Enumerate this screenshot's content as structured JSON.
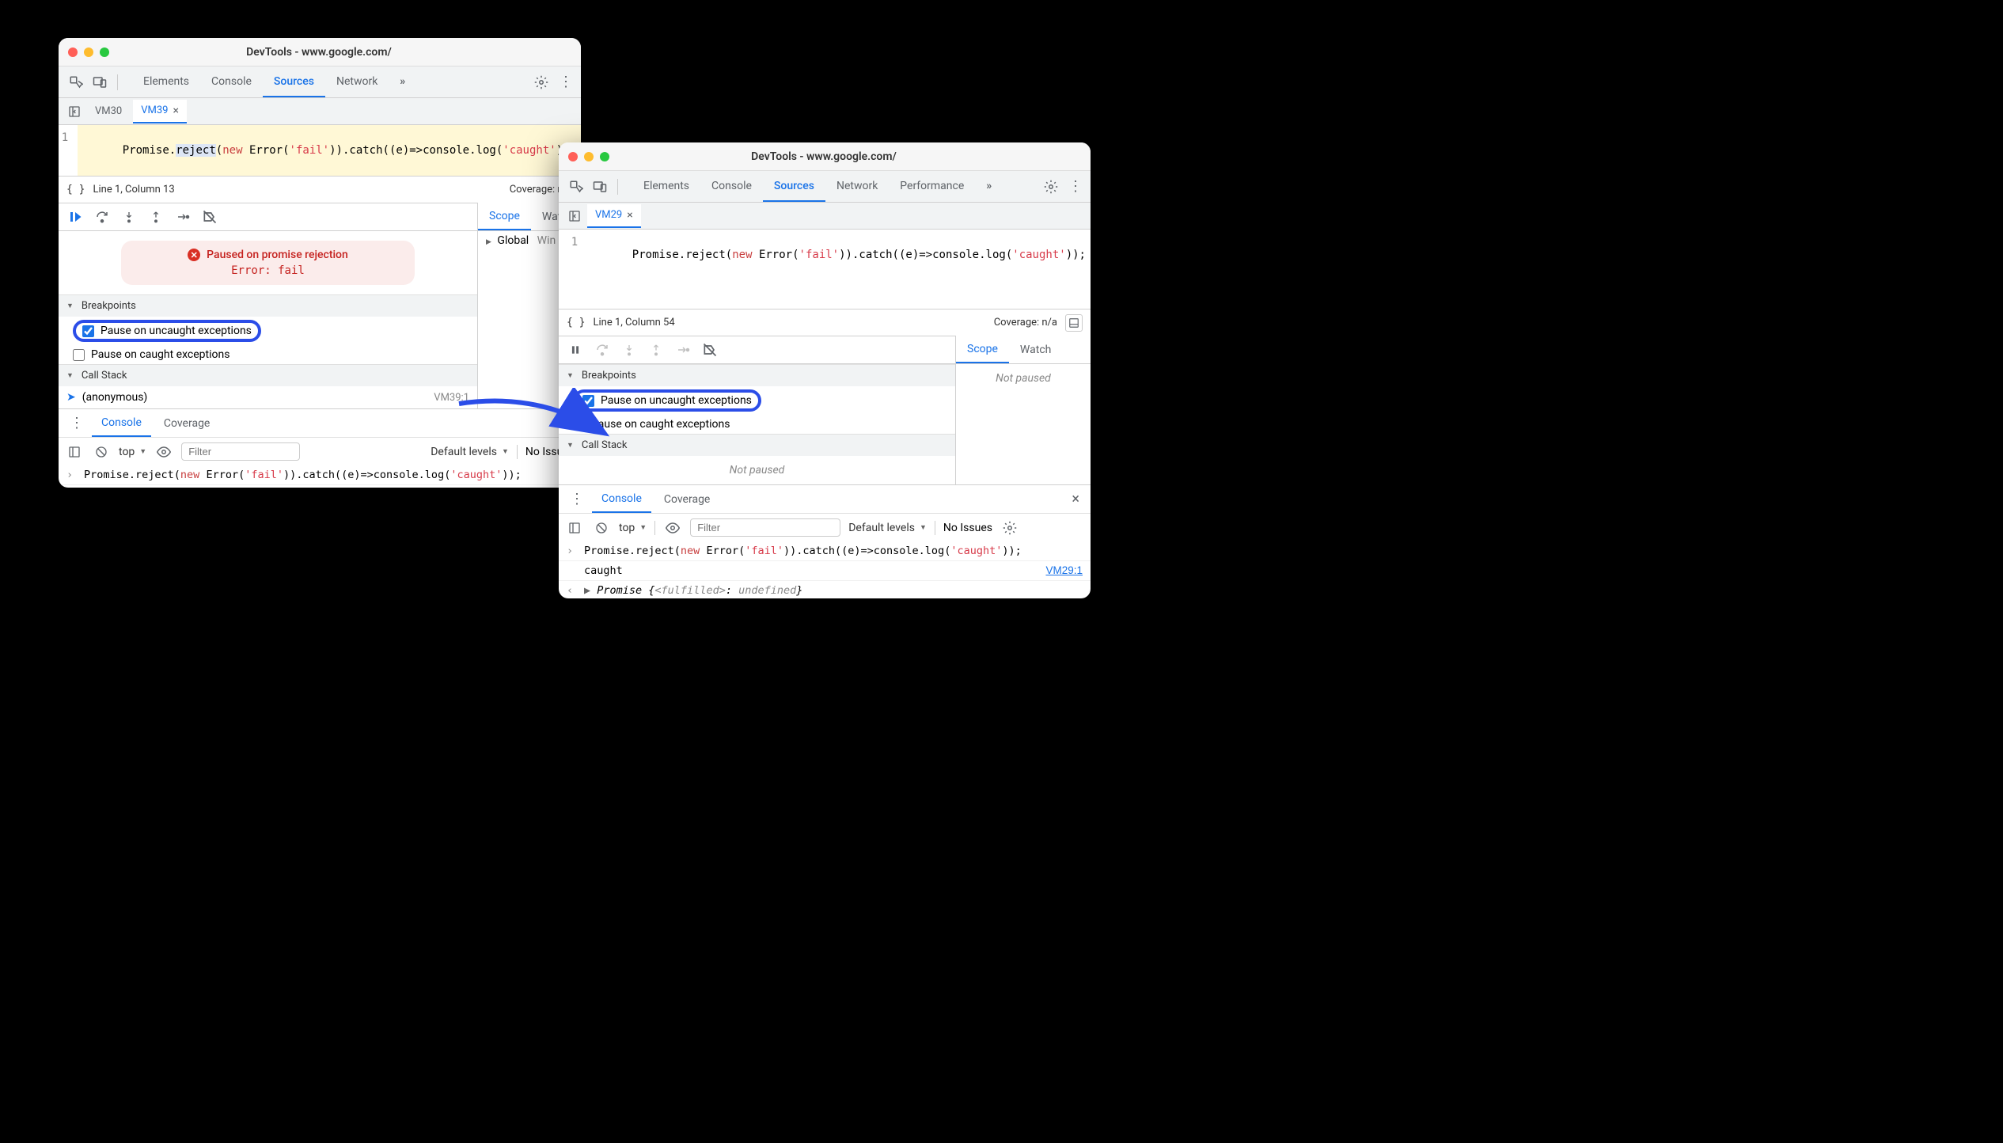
{
  "windowA": {
    "title": "DevTools - www.google.com/",
    "tabs": [
      "Elements",
      "Console",
      "Sources",
      "Network"
    ],
    "activeTab": "Sources",
    "fileTabs": {
      "inactive": "VM30",
      "active": "VM39"
    },
    "code": {
      "lineNo": "1",
      "parts": {
        "p1": "Promise.",
        "sel": "reject",
        "p2": "(",
        "kw": "new",
        "p3": " Error(",
        "str1": "'fail'",
        "p4": ")).catch((e)=>console.log(",
        "str2": "'caught'",
        "p5": "));"
      }
    },
    "status": {
      "cursor": "Line 1, Column 13",
      "coverage": "Coverage: n/a"
    },
    "pauseMsg": {
      "title": "Paused on promise rejection",
      "sub": "Error: fail"
    },
    "bpSection": "Breakpoints",
    "bp1": "Pause on uncaught exceptions",
    "bp2": "Pause on caught exceptions",
    "csSection": "Call Stack",
    "csItem": "(anonymous)",
    "csSrc": "VM39:1",
    "scope": {
      "tabScope": "Scope",
      "tabWatch": "Watch",
      "global": "Global",
      "win": "Win"
    },
    "drawer": {
      "console": "Console",
      "coverage": "Coverage"
    },
    "consoleTb": {
      "ctx": "top",
      "filter": "Filter",
      "levels": "Default levels",
      "issues": "No Issues"
    },
    "consoleLines": {
      "input": {
        "p1": "Promise.reject(",
        "kw": "new",
        "p2": " Error(",
        "str1": "'fail'",
        "p3": ")).catch((e)=>console.log(",
        "str2": "'caught'",
        "p4": "));"
      }
    }
  },
  "windowB": {
    "title": "DevTools - www.google.com/",
    "tabs": [
      "Elements",
      "Console",
      "Sources",
      "Network",
      "Performance"
    ],
    "activeTab": "Sources",
    "fileTabs": {
      "active": "VM29"
    },
    "code": {
      "lineNo": "1",
      "parts": {
        "p1": "Promise.reject(",
        "kw": "new",
        "p2": " Error(",
        "str1": "'fail'",
        "p3": ")).catch((e)=>console.log(",
        "str2": "'caught'",
        "p4": "));"
      }
    },
    "status": {
      "cursor": "Line 1, Column 54",
      "coverage": "Coverage: n/a"
    },
    "bpSection": "Breakpoints",
    "bp1": "Pause on uncaught exceptions",
    "bp2": "Pause on caught exceptions",
    "csSection": "Call Stack",
    "notPaused": "Not paused",
    "scope": {
      "tabScope": "Scope",
      "tabWatch": "Watch",
      "notPaused": "Not paused"
    },
    "drawer": {
      "console": "Console",
      "coverage": "Coverage"
    },
    "consoleTb": {
      "ctx": "top",
      "filter": "Filter",
      "levels": "Default levels",
      "issues": "No Issues"
    },
    "consoleLines": {
      "input": {
        "p1": "Promise.reject(",
        "kw": "new",
        "p2": " Error(",
        "str1": "'fail'",
        "p3": ")).catch((e)=>console.log(",
        "str2": "'caught'",
        "p4": "));"
      },
      "log": "caught",
      "logSrc": "VM29:1",
      "ret": {
        "p1": "Promise {",
        "state": "<fulfilled>",
        "sep": ": ",
        "val": "undefined",
        "p2": "}"
      }
    }
  }
}
